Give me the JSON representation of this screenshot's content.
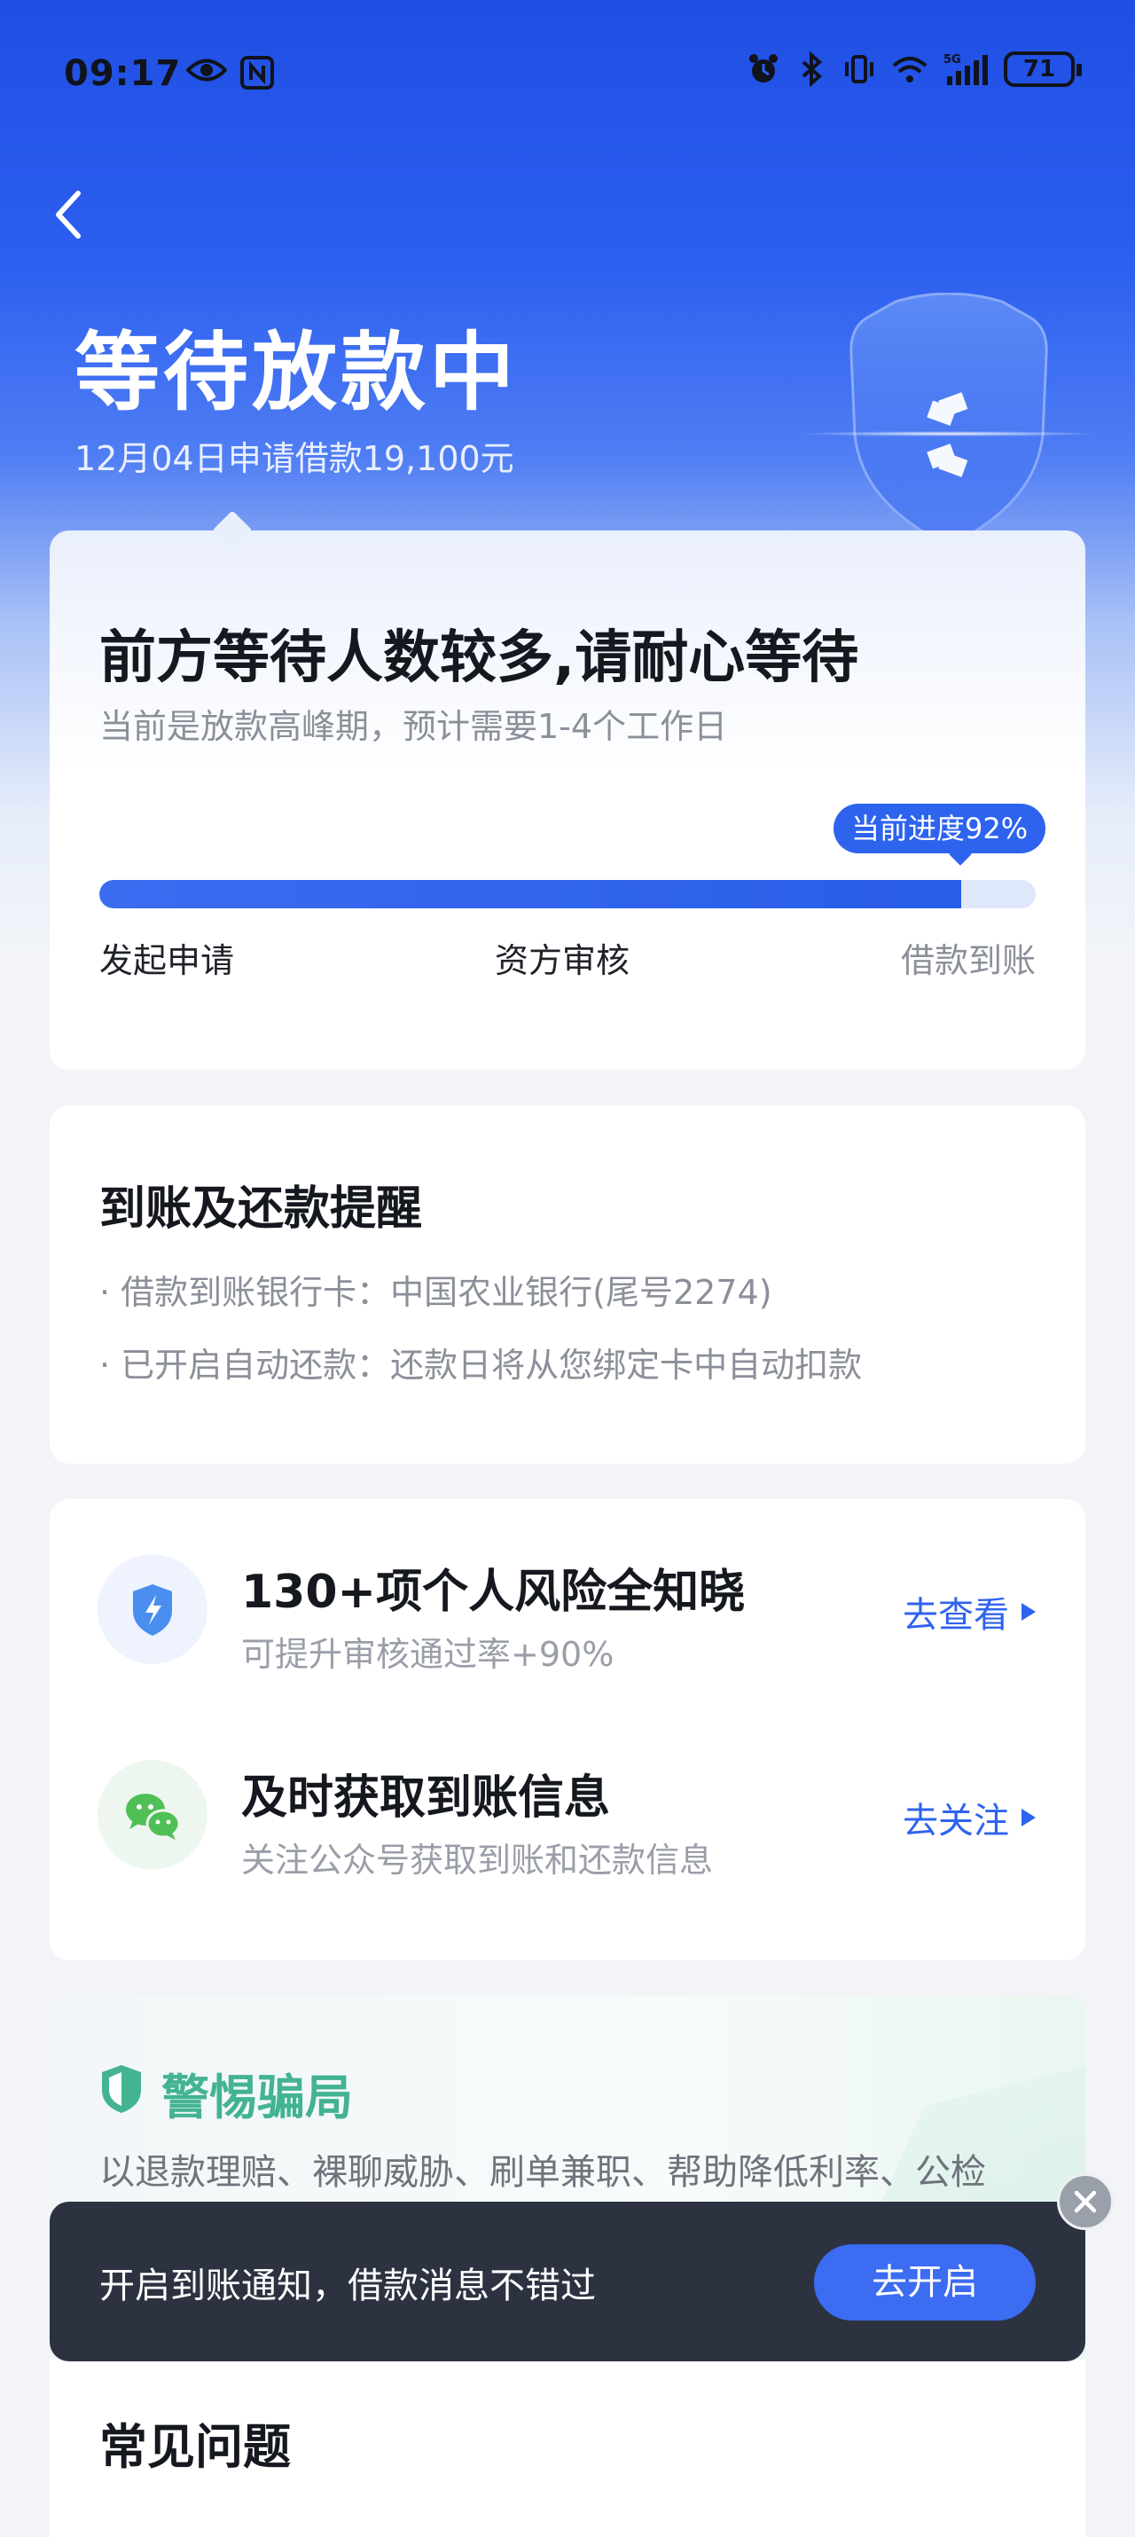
{
  "status_bar": {
    "time": "09:17",
    "battery": "71",
    "icons": [
      "eye-icon",
      "nfc-icon",
      "alarm-icon",
      "bluetooth-icon",
      "vibrate-icon",
      "wifi-icon",
      "signal-5g-icon",
      "battery-icon"
    ]
  },
  "header": {
    "title": "等待放款中",
    "subtitle": "12月04日申请借款19,100元"
  },
  "progress_card": {
    "headline": "前方等待人数较多,请耐心等待",
    "description": "当前是放款高峰期，预计需要1-4个工作日",
    "badge": "当前进度92%",
    "progress_fraction": 0.92,
    "steps": [
      "发起申请",
      "资方审核",
      "借款到账"
    ]
  },
  "reminder_card": {
    "title": "到账及还款提醒",
    "items": [
      "· 借款到账银行卡：中国农业银行(尾号2274)",
      "· 已开启自动还款：还款日将从您绑定卡中自动扣款"
    ]
  },
  "action_card": {
    "rows": [
      {
        "title": "130+项个人风险全知晓",
        "subtitle": "可提升审核通过率+90%",
        "link": "去查看",
        "icon": "shield-lightning-icon"
      },
      {
        "title": "及时获取到账信息",
        "subtitle": "关注公众号获取到账和还款信息",
        "link": "去关注",
        "icon": "wechat-icon"
      }
    ]
  },
  "fraud_card": {
    "title": "警惕骗局",
    "text": "以退款理赔、裸聊威胁、刷单兼职、帮助降低利率、公检"
  },
  "toast": {
    "text": "开启到账通知，借款消息不错过",
    "button": "去开启"
  },
  "faq_card": {
    "title": "常见问题"
  },
  "colors": {
    "primary": "#2e63ee",
    "hero_top": "#1f4ee3",
    "fraud_green": "#43b392",
    "toast_bg": "#2c3240"
  }
}
